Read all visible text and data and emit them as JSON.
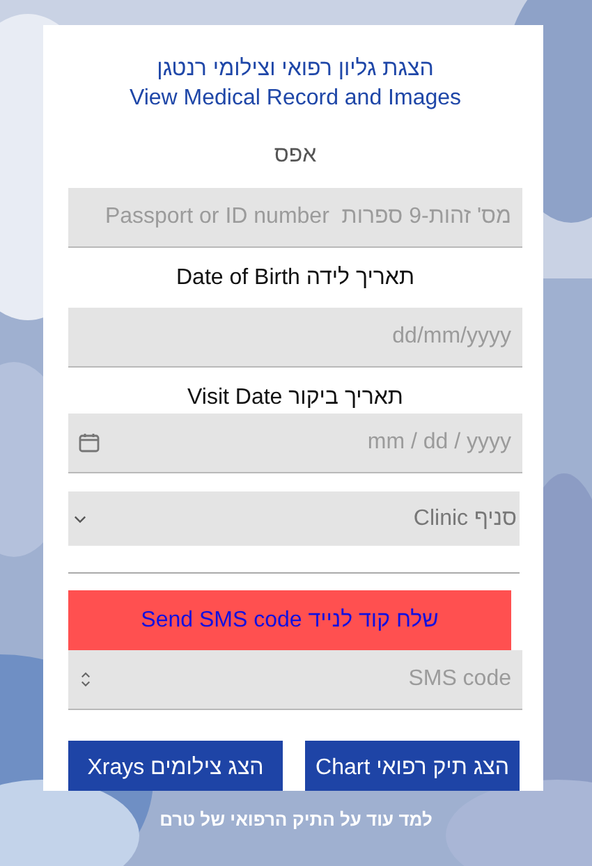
{
  "header": {
    "title_hebrew": "הצגת גליון רפואי וצילומי רנטגן",
    "title_english": "View Medical Record and Images"
  },
  "status_text": "אפס",
  "id_field": {
    "placeholder": "מס' זהות-9 ספרות  Passport or ID number"
  },
  "birth_date": {
    "label": "תאריך לידה Date of Birth",
    "placeholder": "dd/mm/yyyy"
  },
  "visit_date": {
    "label": "תאריך ביקור Visit Date",
    "placeholder": "mm / dd / yyyy"
  },
  "clinic_select": {
    "placeholder": "סניף Clinic"
  },
  "sms_button": {
    "label": "שלח קוד לנייד Send SMS code"
  },
  "sms_field": {
    "placeholder": "SMS code"
  },
  "buttons": [
    {
      "label": "הצג תיק רפואי Chart"
    },
    {
      "label": "הצג צילומים  Xrays"
    }
  ],
  "footer_link": "למד עוד על התיק הרפואי של טרם"
}
